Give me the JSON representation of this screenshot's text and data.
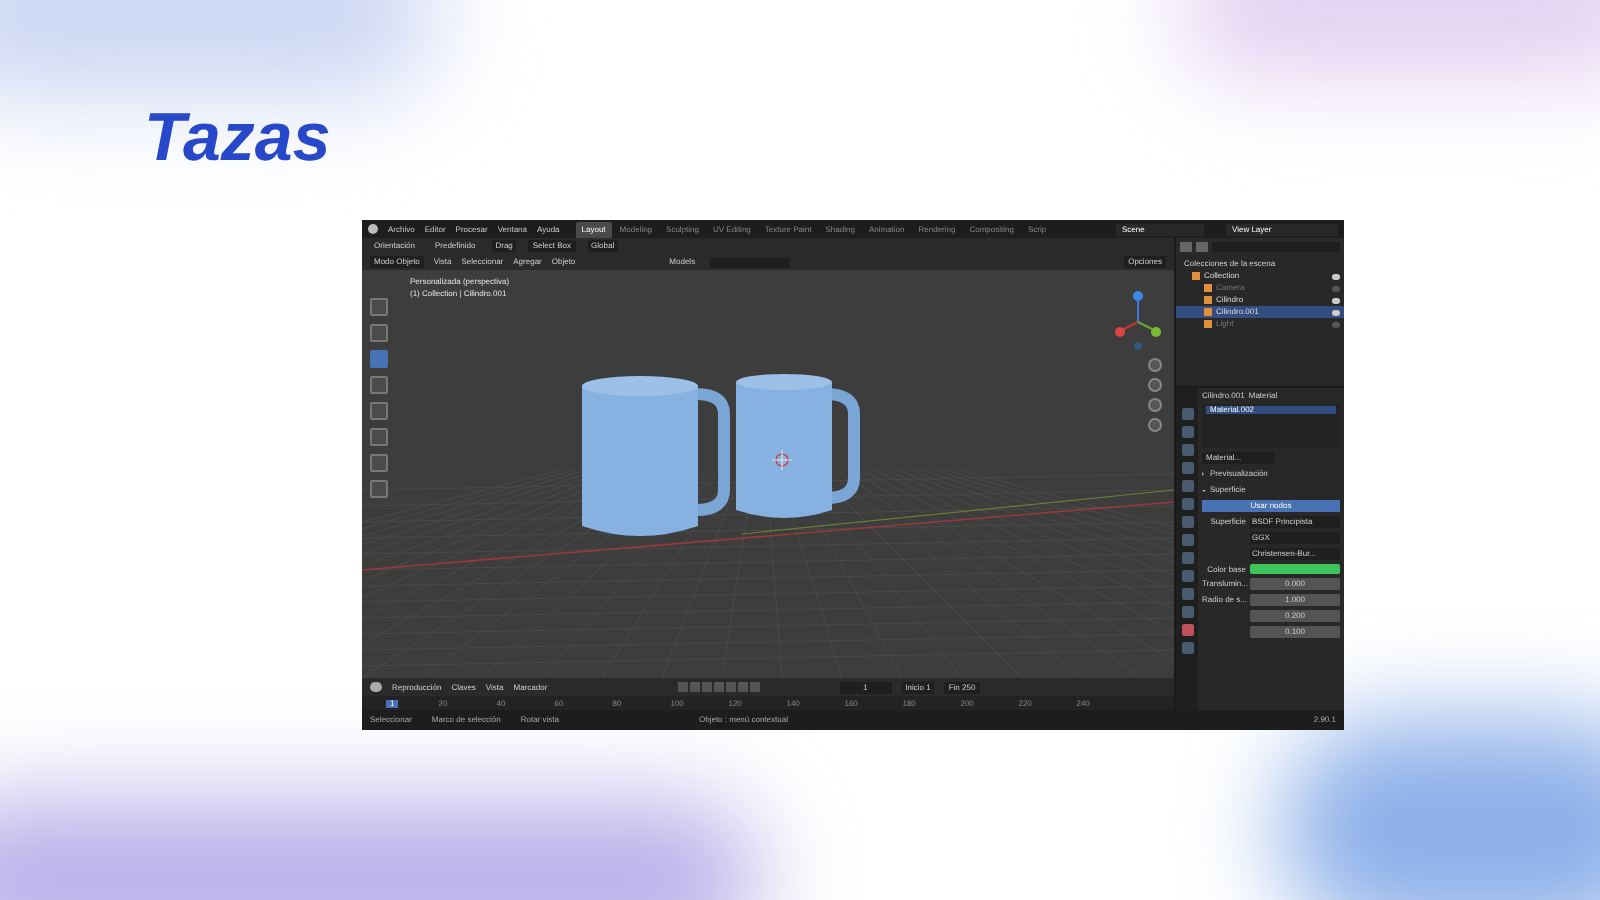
{
  "slide": {
    "title": "Tazas"
  },
  "app": {
    "menu": [
      "Archivo",
      "Editor",
      "Procesar",
      "Ventana",
      "Ayuda"
    ],
    "workspaces": [
      {
        "label": "Layout",
        "selected": true
      },
      {
        "label": "Modeling",
        "selected": false
      },
      {
        "label": "Sculpting",
        "selected": false
      },
      {
        "label": "UV Editing",
        "selected": false
      },
      {
        "label": "Texture Paint",
        "selected": false
      },
      {
        "label": "Shading",
        "selected": false
      },
      {
        "label": "Animation",
        "selected": false
      },
      {
        "label": "Rendering",
        "selected": false
      },
      {
        "label": "Compositing",
        "selected": false
      },
      {
        "label": "Scrip",
        "selected": false
      }
    ],
    "scene": "Scene",
    "view_layer": "View Layer",
    "tool_header": [
      "Orientación",
      "Predefinido",
      "Drag",
      "Select Box",
      "Global"
    ],
    "viewport_header": {
      "mode": "Modo Objeto",
      "menus": [
        "Vista",
        "Seleccionar",
        "Agregar",
        "Objeto"
      ],
      "collection": "Models",
      "options": "Opciones"
    },
    "viewport_overlay": [
      "Personalizada (perspectiva)",
      "(1) Collection | Cilindro.001"
    ],
    "outliner": {
      "title": "Colecciones de la escena",
      "items": [
        {
          "label": "Collection",
          "selected": false,
          "visible": true,
          "children": [
            {
              "label": "Camera",
              "selected": false,
              "visible": false
            },
            {
              "label": "Cilindro",
              "selected": false,
              "visible": true
            },
            {
              "label": "Cilindro.001",
              "selected": true,
              "visible": true
            },
            {
              "label": "Light",
              "selected": false,
              "visible": false
            }
          ]
        }
      ]
    },
    "properties": {
      "object": "Cilindro.001",
      "tab": "Material",
      "slot": "Material.002",
      "material": "Material...",
      "sections": [
        {
          "label": "Previsualización",
          "expanded": false
        },
        {
          "label": "Superficie",
          "expanded": true
        }
      ],
      "use_nodes": "Usar nodos",
      "fields": [
        {
          "kind": "dropdown",
          "label": "Superficie",
          "value": "BSDF Principista"
        },
        {
          "kind": "dropdown",
          "value": "GGX"
        },
        {
          "kind": "dropdown",
          "value": "Christensen-Bur..."
        },
        {
          "kind": "color",
          "label": "Color base",
          "color": "#3ec45a"
        },
        {
          "kind": "number",
          "label": "Translumin...",
          "value": "0.000"
        },
        {
          "kind": "number",
          "label": "Radio de s...",
          "value": "1.000"
        },
        {
          "kind": "number",
          "value": "0.200"
        },
        {
          "kind": "number",
          "value": "0.100"
        }
      ]
    },
    "timeline": {
      "menus": [
        "Reproducción",
        "Claves",
        "Vista",
        "Marcador"
      ],
      "frame": "1",
      "start_label": "Inicio",
      "start": "1",
      "end_label": "Fin",
      "end": "250",
      "playhead": "1",
      "ticks": [
        "20",
        "40",
        "60",
        "80",
        "100",
        "120",
        "140",
        "160",
        "180",
        "200",
        "220",
        "240"
      ]
    },
    "status_bar": {
      "hints": [
        "Seleccionar",
        "Marco de selección",
        "Rotar vista",
        "Objeto : menú contextual"
      ],
      "version": "2.90.1"
    }
  }
}
